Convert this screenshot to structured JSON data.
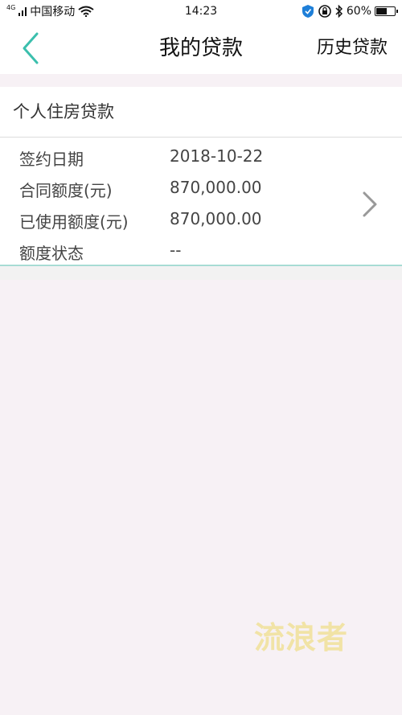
{
  "status_bar": {
    "network_type": "4G",
    "carrier": "中国移动",
    "time": "14:23",
    "battery_percent": "60%",
    "battery_level": 0.6
  },
  "nav": {
    "title": "我的贷款",
    "history_label": "历史贷款"
  },
  "loan_card": {
    "title": "个人住房贷款",
    "fields": [
      {
        "label": "签约日期",
        "value": "2018-10-22"
      },
      {
        "label": "合同额度(元)",
        "value": "870,000.00"
      },
      {
        "label": "已使用额度(元)",
        "value": "870,000.00"
      },
      {
        "label": "额度状态",
        "value": "--"
      }
    ]
  },
  "watermark": "流浪者",
  "colors": {
    "accent": "#3bbfad",
    "page_bg": "#f7f1f5",
    "watermark": "#f1e3a6"
  },
  "icons": {
    "back": "chevron-left-icon",
    "row_arrow": "chevron-right-icon"
  }
}
